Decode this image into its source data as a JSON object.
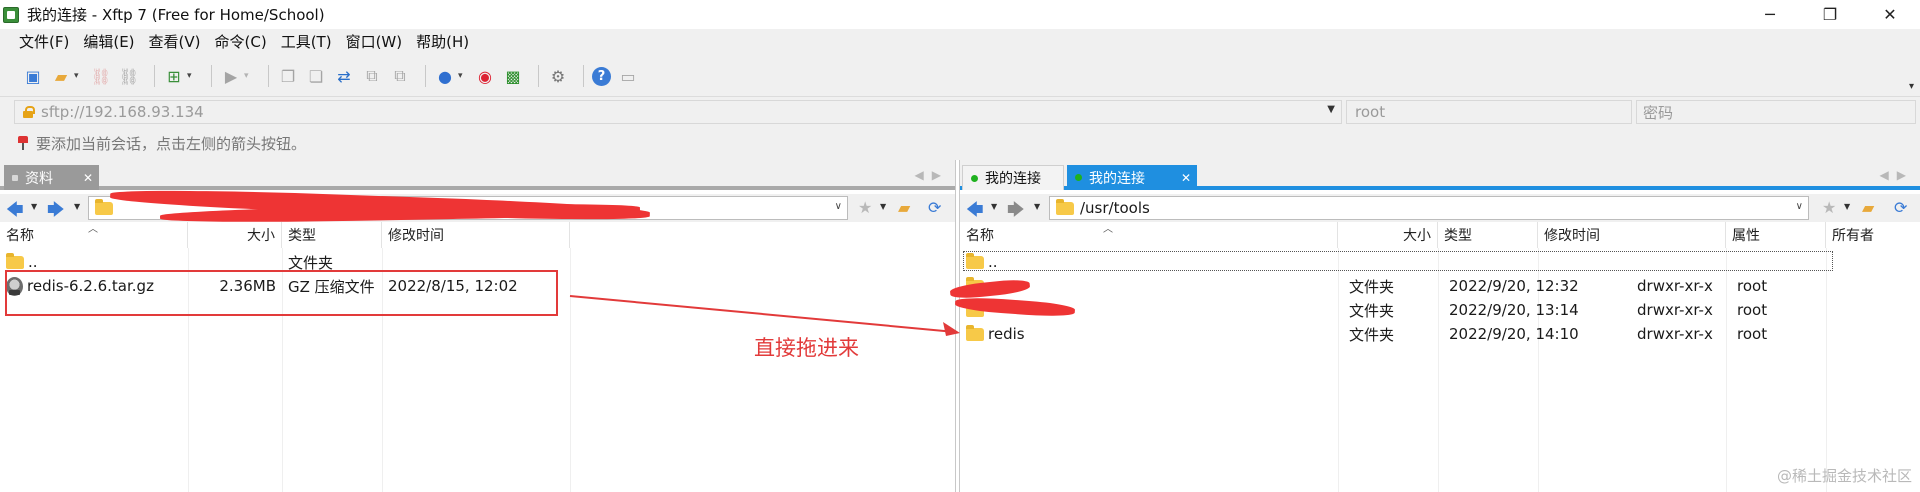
{
  "window": {
    "title": "我的连接 - Xftp 7 (Free for Home/School)",
    "controls": [
      "─",
      "❐",
      "✕"
    ]
  },
  "menu": [
    "文件(F)",
    "编辑(E)",
    "查看(V)",
    "命令(C)",
    "工具(T)",
    "窗口(W)",
    "帮助(H)"
  ],
  "address": {
    "url": "sftp://192.168.93.134",
    "username": "root",
    "password_placeholder": "密码"
  },
  "hint": "要添加当前会话，点击左侧的箭头按钮。",
  "left_panel": {
    "tab": "资料",
    "columns": [
      "名称",
      "大小",
      "类型",
      "修改时间"
    ],
    "rows": [
      {
        "name": "..",
        "size": "",
        "type": "文件夹",
        "modified": ""
      },
      {
        "name": "redis-6.2.6.tar.gz",
        "size": "2.36MB",
        "type": "GZ 压缩文件",
        "modified": "2022/8/15, 12:02"
      }
    ]
  },
  "right_panel": {
    "tabs": [
      "我的连接",
      "我的连接"
    ],
    "path": "/usr/tools",
    "columns": [
      "名称",
      "大小",
      "类型",
      "修改时间",
      "属性",
      "所有者"
    ],
    "rows": [
      {
        "name": "..",
        "size": "",
        "type": "",
        "modified": "",
        "attrs": "",
        "owner": ""
      },
      {
        "name": "",
        "size": "",
        "type": "文件夹",
        "modified": "2022/9/20, 12:32",
        "attrs": "drwxr-xr-x",
        "owner": "root"
      },
      {
        "name": "",
        "size": "",
        "type": "文件夹",
        "modified": "2022/9/20, 13:14",
        "attrs": "drwxr-xr-x",
        "owner": "root"
      },
      {
        "name": "redis",
        "size": "",
        "type": "文件夹",
        "modified": "2022/9/20, 14:10",
        "attrs": "drwxr-xr-x",
        "owner": "root"
      }
    ]
  },
  "annotation": {
    "text": "直接拖进来"
  },
  "watermark": "@稀土掘金技术社区",
  "colors": {
    "active_tab": "#1f8fe0",
    "annotation_red": "#e23a3a",
    "folder": "#f7c948",
    "tab_green_dot": "#1fb11f"
  }
}
